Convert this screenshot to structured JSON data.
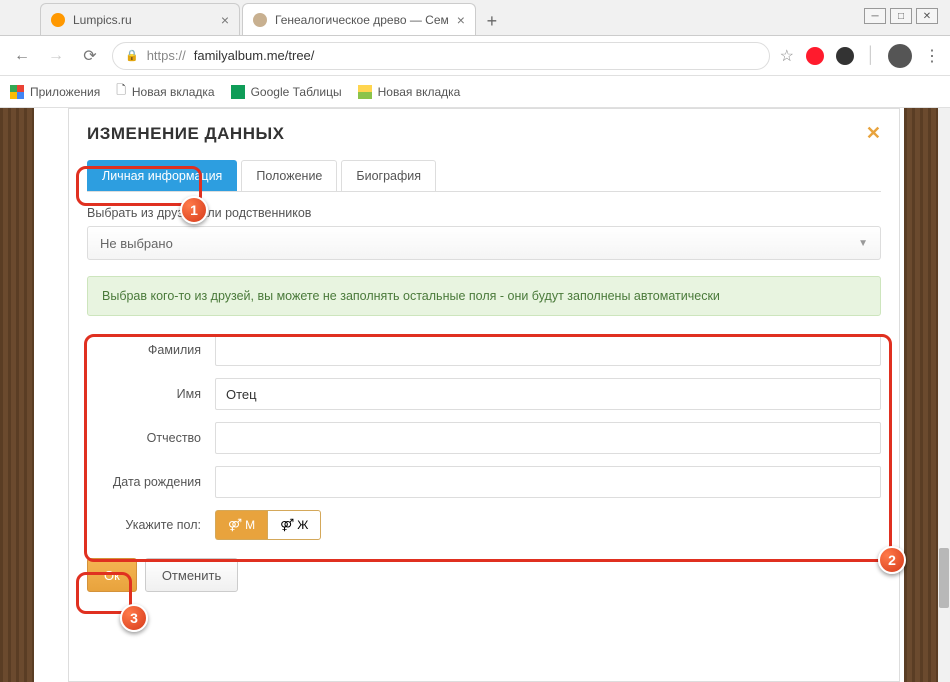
{
  "browser": {
    "tabs": [
      {
        "title": "Lumpics.ru"
      },
      {
        "title": "Генеалогическое древо — Сем"
      }
    ],
    "url_protocol": "https://",
    "url_rest": "familyalbum.me/tree/"
  },
  "bookmarks": {
    "apps": "Приложения",
    "items": [
      "Новая вкладка",
      "Google Таблицы",
      "Новая вкладка"
    ]
  },
  "modal": {
    "title": "ИЗМЕНЕНИЕ ДАННЫХ",
    "tabs": [
      "Личная информация",
      "Положение",
      "Биография"
    ],
    "friend_select_label": "Выбрать из друзей или родственников",
    "friend_select_value": "Не выбрано",
    "info_text": "Выбрав кого-то из друзей, вы можете не заполнять остальные поля - они будут заполнены автоматически",
    "fields": {
      "surname": {
        "label": "Фамилия",
        "value": ""
      },
      "name": {
        "label": "Имя",
        "value": "Отец"
      },
      "patronymic": {
        "label": "Отчество",
        "value": ""
      },
      "dob": {
        "label": "Дата рождения",
        "value": ""
      },
      "gender": {
        "label": "Укажите пол:",
        "male": "М",
        "female": "Ж"
      }
    },
    "buttons": {
      "ok": "Ок",
      "cancel": "Отменить"
    }
  },
  "annotations": {
    "b1": "1",
    "b2": "2",
    "b3": "3"
  }
}
